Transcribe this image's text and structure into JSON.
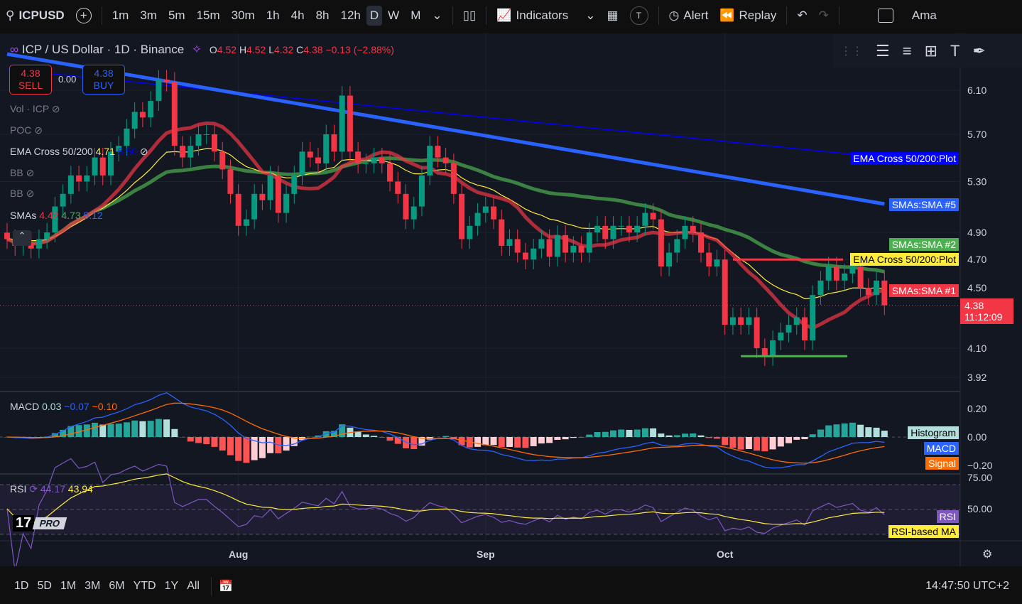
{
  "toolbar": {
    "symbol": "ICPUSD",
    "intervals": [
      "1m",
      "3m",
      "5m",
      "15m",
      "30m",
      "1h",
      "4h",
      "8h",
      "12h",
      "D",
      "W",
      "M"
    ],
    "active_interval": "D",
    "indicators": "Indicators",
    "alert": "Alert",
    "replay": "Replay",
    "extra": "Ama",
    "t_badge": "T"
  },
  "legend": {
    "title": "ICP / US Dollar · 1D · Binance",
    "o_label": "O",
    "o": "4.52",
    "h_label": "H",
    "h": "4.52",
    "l_label": "L",
    "l": "4.32",
    "c_label": "C",
    "c": "4.38",
    "change": "−0.13 (−2.88%)",
    "sell_price": "4.38",
    "sell": "SELL",
    "spread": "0.00",
    "buy_price": "4.38",
    "buy": "BUY",
    "vol": "Vol · ICP",
    "poc": "POC",
    "ema": "EMA Cross 50/200",
    "ema_v1": "4.71",
    "ema_v2": "5.50",
    "bb1": "BB",
    "bb2": "BB",
    "smas": "SMAs",
    "sma_v1": "4.42",
    "sma_v2": "4.73",
    "sma_v3": "5.12",
    "macd": "MACD",
    "macd_v1": "0.03",
    "macd_v2": "−0.07",
    "macd_v3": "−0.10",
    "rsi": "RSI",
    "rsi_v1": "44.17",
    "rsi_v2": "43.94",
    "pro": "PRO"
  },
  "tags": {
    "ema_plot_blue": "EMA Cross 50/200:Plot",
    "sma5": "SMAs:SMA #5",
    "sma2": "SMAs:SMA #2",
    "ema_plot_yellow": "EMA Cross 50/200:Plot",
    "sma1": "SMAs:SMA #1",
    "price": "4.38",
    "countdown": "11:12:09",
    "histogram": "Histogram",
    "macd": "MACD",
    "signal": "Signal",
    "rsi": "RSI",
    "rsi_ma": "RSI-based MA"
  },
  "bottom": {
    "ranges": [
      "1D",
      "5D",
      "1M",
      "3M",
      "6M",
      "YTD",
      "1Y",
      "All"
    ],
    "clock": "14:47:50 UTC+2"
  },
  "colors": {
    "up": "#089981",
    "down": "#f23645",
    "sma1": "#f23645",
    "sma2": "#4caf50",
    "sma5": "#2962ff",
    "ema200": "#0000ff",
    "ema50": "#ffeb3b"
  },
  "chart_data": {
    "type": "candlestick",
    "scale": "log",
    "price_ticks": [
      "6.10",
      "5.70",
      "5.30",
      "4.90",
      "4.70",
      "4.50",
      "4.10",
      "3.92"
    ],
    "price_tick_values": [
      6.1,
      5.7,
      5.3,
      4.9,
      4.7,
      4.5,
      4.1,
      3.92
    ],
    "x_labels": [
      {
        "label": "Aug",
        "index": 29
      },
      {
        "label": "Sep",
        "index": 60
      },
      {
        "label": "Oct",
        "index": 90
      }
    ],
    "closes": [
      4.85,
      4.8,
      4.82,
      4.78,
      4.85,
      4.9,
      5.1,
      5.2,
      5.35,
      5.3,
      5.35,
      5.5,
      5.35,
      5.55,
      5.6,
      5.75,
      5.9,
      5.85,
      6.0,
      6.2,
      6.18,
      5.6,
      5.5,
      5.6,
      5.7,
      5.7,
      5.55,
      5.4,
      5.2,
      4.95,
      5.0,
      5.2,
      5.15,
      5.35,
      5.05,
      5.2,
      5.35,
      5.55,
      5.5,
      5.45,
      5.7,
      5.55,
      6.05,
      5.55,
      5.45,
      5.45,
      5.5,
      5.45,
      5.3,
      5.2,
      5.0,
      5.1,
      5.35,
      5.6,
      5.5,
      5.45,
      5.2,
      4.85,
      4.95,
      5.05,
      5.1,
      5.0,
      4.8,
      4.85,
      4.75,
      4.7,
      4.78,
      4.85,
      4.72,
      4.88,
      4.75,
      4.8,
      4.75,
      4.9,
      4.95,
      4.85,
      4.95,
      4.95,
      4.9,
      4.95,
      5.05,
      5.0,
      4.65,
      4.75,
      4.85,
      4.95,
      4.9,
      4.75,
      4.65,
      4.7,
      4.25,
      4.3,
      4.25,
      4.3,
      4.1,
      4.05,
      4.15,
      4.2,
      4.25,
      4.3,
      4.15,
      4.45,
      4.55,
      4.65,
      4.55,
      4.6,
      4.65,
      4.5,
      4.45,
      4.55,
      4.38
    ],
    "sma5_line": [
      [
        0,
        6.45
      ],
      [
        110,
        5.12
      ]
    ],
    "ema200_line": [
      [
        0,
        6.3
      ],
      [
        110,
        5.5
      ]
    ],
    "hlines": [
      {
        "price": 4.7,
        "color": "#f23645"
      },
      {
        "price": 4.05,
        "color": "#4caf50"
      }
    ],
    "macd_ticks": [
      "0.20",
      "0.00",
      "−0.20"
    ],
    "rsi_ticks": [
      "75.00",
      "50.00"
    ]
  }
}
